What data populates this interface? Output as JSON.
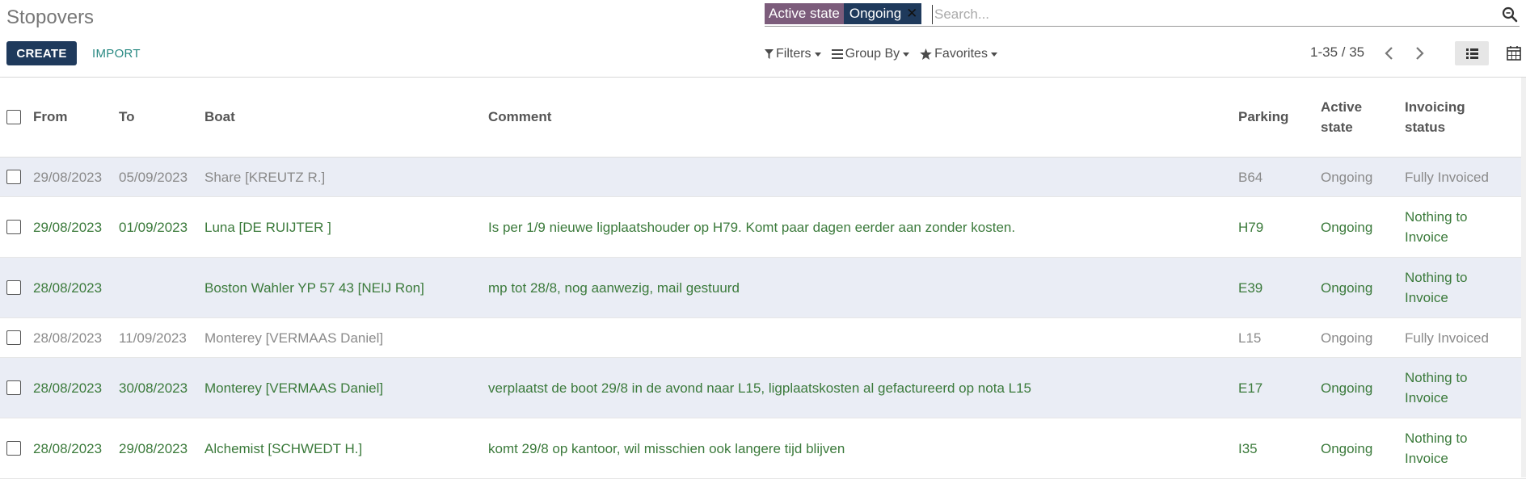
{
  "page": {
    "title": "Stopovers"
  },
  "toolbar": {
    "create_label": "CREATE",
    "import_label": "IMPORT"
  },
  "search": {
    "facet_name": "Active state",
    "facet_value": "Ongoing",
    "facet_close_glyph": "✕",
    "placeholder": "Search..."
  },
  "filters": {
    "filters_label": "Filters",
    "groupby_label": "Group By",
    "favorites_label": "Favorites"
  },
  "pager": {
    "range": "1-35 / 35"
  },
  "table": {
    "headers": {
      "from": "From",
      "to": "To",
      "boat": "Boat",
      "comment": "Comment",
      "parking": "Parking",
      "active_state_1": "Active",
      "active_state_2": "state",
      "invoicing_1": "Invoicing",
      "invoicing_2": "status"
    },
    "rows": [
      {
        "from": "29/08/2023",
        "to": "05/09/2023",
        "boat": "Share [KREUTZ R.]",
        "comment": "",
        "parking": "B64",
        "state": "Ongoing",
        "inv1": "Fully Invoiced",
        "inv2": "",
        "status": "done"
      },
      {
        "from": "29/08/2023",
        "to": "01/09/2023",
        "boat": "Luna [DE RUIJTER ]",
        "comment": "Is per 1/9 nieuwe ligplaatshouder op H79. Komt paar dagen eerder aan zonder kosten.",
        "parking": "H79",
        "state": "Ongoing",
        "inv1": "Nothing to",
        "inv2": "Invoice",
        "status": "todo"
      },
      {
        "from": "28/08/2023",
        "to": "",
        "boat": "Boston Wahler YP 57 43 [NEIJ Ron]",
        "comment": "mp tot 28/8, nog aanwezig, mail gestuurd",
        "parking": "E39",
        "state": "Ongoing",
        "inv1": "Nothing to",
        "inv2": "Invoice",
        "status": "todo"
      },
      {
        "from": "28/08/2023",
        "to": "11/09/2023",
        "boat": "Monterey [VERMAAS Daniel]",
        "comment": "",
        "parking": "L15",
        "state": "Ongoing",
        "inv1": "Fully Invoiced",
        "inv2": "",
        "status": "done"
      },
      {
        "from": "28/08/2023",
        "to": "30/08/2023",
        "boat": "Monterey [VERMAAS Daniel]",
        "comment": "verplaatst de boot 29/8 in de avond naar L15, ligplaatskosten al gefactureerd op nota L15",
        "parking": "E17",
        "state": "Ongoing",
        "inv1": "Nothing to",
        "inv2": "Invoice",
        "status": "todo"
      },
      {
        "from": "28/08/2023",
        "to": "29/08/2023",
        "boat": "Alchemist [SCHWEDT H.]",
        "comment": "komt 29/8 op kantoor, wil misschien ook langere tijd blijven",
        "parking": "I35",
        "state": "Ongoing",
        "inv1": "Nothing to",
        "inv2": "Invoice",
        "status": "todo"
      }
    ]
  }
}
